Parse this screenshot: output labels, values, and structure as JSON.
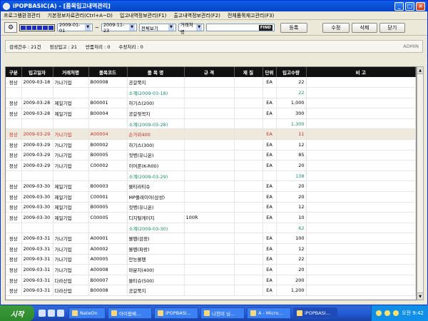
{
  "window": {
    "title": "iPOPBASIC(A) - [품목입고내역관리]"
  },
  "menu": [
    "프로그램환경관리",
    "기본정보자료관리(Ctrl+A~D)",
    "입고내역정보관리(F1)",
    "출고내역정보관리(F2)",
    "전체품목재고관리(F3)"
  ],
  "toolbar": {
    "date_from": "2009-01-01",
    "date_sep": "~",
    "date_to": "2009-11-23",
    "view_select": "전체보기",
    "vendor_select": "거래처명",
    "search_value": "",
    "find_label": "FIND",
    "register_label": "등록",
    "edit_label": "수정",
    "delete_label": "삭제",
    "close_label": "닫기"
  },
  "summary": {
    "total_label": "검색건수 : 21건",
    "normal_label": "정상입고 : 21",
    "return_label": "반품처리 : 0",
    "modify_label": "수정처리 : 0",
    "user": "ADMIN"
  },
  "table": {
    "headers": [
      "구분",
      "입고일자",
      "거래처명",
      "품목코드",
      "품 목 명",
      "규 격",
      "재 질",
      "단위",
      "입고수량",
      "비 고"
    ],
    "rows": [
      {
        "type": "정상",
        "date": "2009-03-18",
        "vendor": "가나기업",
        "code": "B00008",
        "name": "공갈쭉지",
        "spec": "",
        "mat": "",
        "unit": "EA",
        "qty": "22",
        "note": ""
      },
      {
        "type": "",
        "date": "",
        "vendor": "",
        "code": "",
        "name": "소계(2009-03-18)",
        "spec": "",
        "mat": "",
        "unit": "",
        "qty": "22",
        "note": "",
        "sub": true
      },
      {
        "type": "정상",
        "date": "2009-03-28",
        "vendor": "제일기업",
        "code": "B00001",
        "name": "하기스(200)",
        "spec": "",
        "mat": "",
        "unit": "EA",
        "qty": "1,000",
        "note": ""
      },
      {
        "type": "정상",
        "date": "2009-03-28",
        "vendor": "제일기업",
        "code": "B00004",
        "name": "공갈젖꼭지",
        "spec": "",
        "mat": "",
        "unit": "EA",
        "qty": "300",
        "note": ""
      },
      {
        "type": "",
        "date": "",
        "vendor": "",
        "code": "",
        "name": "소계(2009-03-28)",
        "spec": "",
        "mat": "",
        "unit": "",
        "qty": "1,300",
        "note": "",
        "sub": true
      },
      {
        "type": "정상",
        "date": "2009-03-29",
        "vendor": "가나기업",
        "code": "A00004",
        "name": "손가위400",
        "spec": "",
        "mat": "",
        "unit": "EA",
        "qty": "11",
        "note": "",
        "hl": true
      },
      {
        "type": "정상",
        "date": "2009-03-29",
        "vendor": "가나기업",
        "code": "B00002",
        "name": "하기스(300)",
        "spec": "",
        "mat": "",
        "unit": "EA",
        "qty": "12",
        "note": ""
      },
      {
        "type": "정상",
        "date": "2009-03-29",
        "vendor": "가나기업",
        "code": "B00005",
        "name": "젓병(유니온)",
        "spec": "",
        "mat": "",
        "unit": "EA",
        "qty": "85",
        "note": ""
      },
      {
        "type": "정상",
        "date": "2009-03-29",
        "vendor": "가나기업",
        "code": "C00002",
        "name": "이어폰(K-R00)",
        "spec": "",
        "mat": "",
        "unit": "EA",
        "qty": "20",
        "note": ""
      },
      {
        "type": "",
        "date": "",
        "vendor": "",
        "code": "",
        "name": "소계(2009-03-29)",
        "spec": "",
        "mat": "",
        "unit": "",
        "qty": "138",
        "note": "",
        "sub": true
      },
      {
        "type": "정상",
        "date": "2009-03-30",
        "vendor": "제일기업",
        "code": "B00003",
        "name": "물티라티슈",
        "spec": "",
        "mat": "",
        "unit": "EA",
        "qty": "20",
        "note": ""
      },
      {
        "type": "정상",
        "date": "2009-03-30",
        "vendor": "제일기업",
        "code": "C00001",
        "name": "MP플레이어(삼성)",
        "spec": "",
        "mat": "",
        "unit": "EA",
        "qty": "20",
        "note": ""
      },
      {
        "type": "정상",
        "date": "2009-03-30",
        "vendor": "제일기업",
        "code": "B00005",
        "name": "젓병(유니온)",
        "spec": "",
        "mat": "",
        "unit": "EA",
        "qty": "12",
        "note": ""
      },
      {
        "type": "정상",
        "date": "2009-03-30",
        "vendor": "제일기업",
        "code": "C00005",
        "name": "디지털게이지",
        "spec": "100R",
        "mat": "",
        "unit": "EA",
        "qty": "10",
        "note": ""
      },
      {
        "type": "",
        "date": "",
        "vendor": "",
        "code": "",
        "name": "소계(2009-03-30)",
        "spec": "",
        "mat": "",
        "unit": "",
        "qty": "62",
        "note": "",
        "sub": true
      },
      {
        "type": "정상",
        "date": "2009-03-31",
        "vendor": "가나기업",
        "code": "A00001",
        "name": "볼펜(검정)",
        "spec": "",
        "mat": "",
        "unit": "EA",
        "qty": "100",
        "note": ""
      },
      {
        "type": "정상",
        "date": "2009-03-31",
        "vendor": "가나기업",
        "code": "A00002",
        "name": "볼펜(파랑)",
        "spec": "",
        "mat": "",
        "unit": "EA",
        "qty": "12",
        "note": ""
      },
      {
        "type": "정상",
        "date": "2009-03-31",
        "vendor": "가나기업",
        "code": "A00005",
        "name": "만능볼펜",
        "spec": "",
        "mat": "",
        "unit": "EA",
        "qty": "22",
        "note": ""
      },
      {
        "type": "정상",
        "date": "2009-03-31",
        "vendor": "가나기업",
        "code": "A00008",
        "name": "마분지(400)",
        "spec": "",
        "mat": "",
        "unit": "EA",
        "qty": "20",
        "note": ""
      },
      {
        "type": "정상",
        "date": "2009-03-31",
        "vendor": "다라산업",
        "code": "B00007",
        "name": "물티슈(500)",
        "spec": "",
        "mat": "",
        "unit": "EA",
        "qty": "200",
        "note": ""
      },
      {
        "type": "정상",
        "date": "2009-03-31",
        "vendor": "다라산업",
        "code": "B00008",
        "name": "공갈쭉지",
        "spec": "",
        "mat": "",
        "unit": "EA",
        "qty": "1,200",
        "note": ""
      }
    ]
  },
  "taskbar": {
    "start_label": "시작",
    "tasks": [
      "NateOn",
      "아이팝베...",
      "iPOPBASI...",
      "나현미 님...",
      "A - Micro...",
      "iPOPBASI..."
    ],
    "clock": "오전 9:42"
  }
}
